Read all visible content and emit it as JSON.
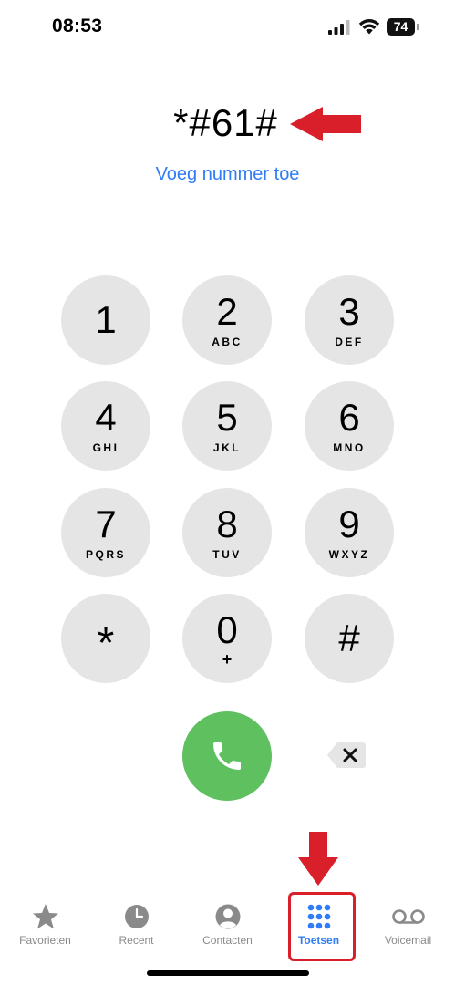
{
  "status_bar": {
    "time": "08:53",
    "battery": "74"
  },
  "dialer": {
    "dialed_number": "*#61#",
    "add_number_label": "Voeg nummer toe"
  },
  "keypad": {
    "keys": [
      {
        "digit": "1",
        "letters": ""
      },
      {
        "digit": "2",
        "letters": "ABC"
      },
      {
        "digit": "3",
        "letters": "DEF"
      },
      {
        "digit": "4",
        "letters": "GHI"
      },
      {
        "digit": "5",
        "letters": "JKL"
      },
      {
        "digit": "6",
        "letters": "MNO"
      },
      {
        "digit": "7",
        "letters": "PQRS"
      },
      {
        "digit": "8",
        "letters": "TUV"
      },
      {
        "digit": "9",
        "letters": "WXYZ"
      },
      {
        "digit": "*",
        "letters": ""
      },
      {
        "digit": "0",
        "letters": "+"
      },
      {
        "digit": "#",
        "letters": ""
      }
    ]
  },
  "tabs": [
    {
      "label": "Favorieten",
      "icon": "star-icon",
      "active": false
    },
    {
      "label": "Recent",
      "icon": "clock-icon",
      "active": false
    },
    {
      "label": "Contacten",
      "icon": "person-icon",
      "active": false
    },
    {
      "label": "Toetsen",
      "icon": "keypad-icon",
      "active": true
    },
    {
      "label": "Voicemail",
      "icon": "voicemail-icon",
      "active": false
    }
  ],
  "colors": {
    "accent": "#2f7cf6",
    "key_background": "#e5e5e5",
    "call_green": "#5ec05f",
    "annotation_red": "#d91f2a",
    "inactive_tab": "#8a8a8a"
  }
}
